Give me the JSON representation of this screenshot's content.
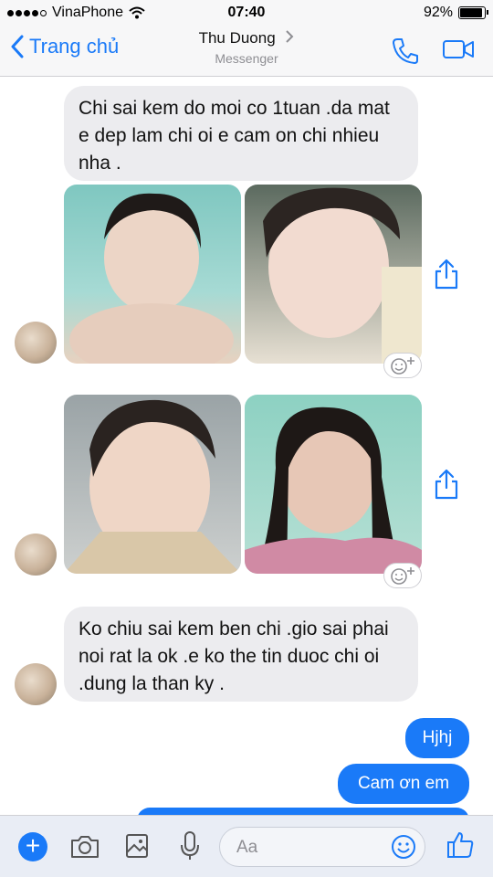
{
  "status_bar": {
    "carrier": "VinaPhone",
    "time": "07:40",
    "battery": "92%",
    "battery_level": 0.92
  },
  "header": {
    "back_label": "Trang chủ",
    "title": "Thu Duong",
    "subtitle": "Messenger"
  },
  "messages": {
    "m1": "Chi sai kem do moi co 1tuan .da mat e dep lam chi oi e cam on chi nhieu nha .",
    "m2": "Ko chiu sai kem ben chi .gio sai phai noi rat la ok .e ko the tin duoc chi oi .dung la than ky .",
    "r1": "Hjhj",
    "r2": "Cam ơn em"
  },
  "composer": {
    "placeholder": "Aa"
  },
  "colors": {
    "accent": "#1a7af8",
    "incoming_bubble": "#ececef",
    "bar_bg": "#f7f7f8"
  },
  "icons": [
    "back-chevron-icon",
    "phone-icon",
    "video-icon",
    "share-icon",
    "add-reaction-icon",
    "plus-icon",
    "camera-icon",
    "gallery-icon",
    "microphone-icon",
    "emoji-icon",
    "like-icon"
  ]
}
